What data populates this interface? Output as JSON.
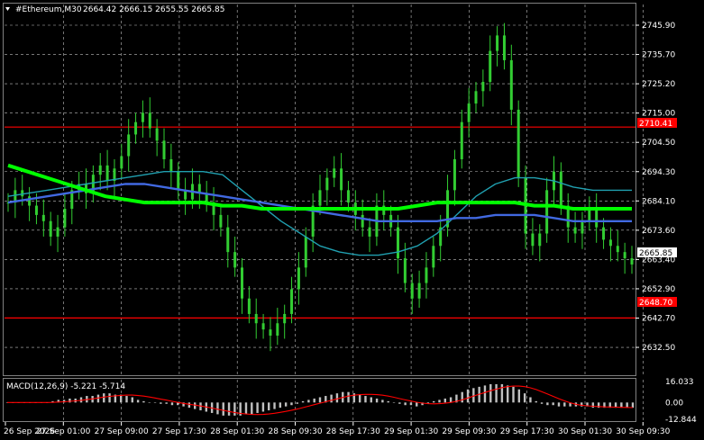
{
  "header": {
    "symbol_timeframe": "#Ethereum,M30",
    "ohlc": "2664.42 2666.15 2655.55 2665.85",
    "dropdown_icon": "triangle-down-icon"
  },
  "macd": {
    "label": "MACD(12,26,9) -5.221 -5.714"
  },
  "price_axis": {
    "ticks": [
      "2745.90",
      "2735.70",
      "2725.20",
      "2715.00",
      "2704.50",
      "2694.30",
      "2684.10",
      "2673.60",
      "2663.40",
      "2652.90",
      "2642.70",
      "2632.50"
    ],
    "current_price": "2665.85",
    "resistance_label": "2710.41",
    "support_label": "2648.70"
  },
  "macd_axis": {
    "ticks": [
      "16.033",
      "0.00",
      "-12.844"
    ]
  },
  "time_axis": {
    "ticks": [
      "26 Sep 2026",
      "27 Sep 01:00",
      "27 Sep 09:00",
      "27 Sep 17:30",
      "28 Sep 01:30",
      "28 Sep 09:30",
      "28 Sep 17:30",
      "29 Sep 01:30",
      "29 Sep 09:30",
      "29 Sep 17:30",
      "30 Sep 01:30",
      "30 Sep 09:30"
    ]
  },
  "colors": {
    "background": "#000000",
    "candle": "#32cd32",
    "grid": "#c0c0c0",
    "level_line": "#ff0000",
    "ma_fast": "#20a0b0",
    "ma_mid": "#4169e1",
    "ma_slow": "#00ff00",
    "macd_hist": "#c0c0c0",
    "macd_signal": "#ff0000"
  },
  "chart_data": {
    "type": "candlestick",
    "title": "#Ethereum,M30",
    "ylim": [
      2630.5,
      2750.0
    ],
    "series": [
      {
        "name": "price",
        "values": [
          2686,
          2690,
          2688,
          2685,
          2682,
          2680,
          2675,
          2678,
          2684,
          2690,
          2692,
          2689,
          2695,
          2698,
          2693,
          2697,
          2701,
          2708,
          2712,
          2715,
          2710,
          2706,
          2700,
          2696,
          2690,
          2687,
          2692,
          2689,
          2686,
          2682,
          2678,
          2670,
          2665,
          2655,
          2650,
          2647,
          2645,
          2643,
          2647,
          2650,
          2658,
          2665,
          2675,
          2685,
          2690,
          2694,
          2697,
          2690,
          2686,
          2682,
          2678,
          2675,
          2685,
          2682,
          2678,
          2668,
          2660,
          2655,
          2660,
          2665,
          2672,
          2678,
          2690,
          2700,
          2712,
          2718,
          2722,
          2725,
          2735,
          2740,
          2732,
          2716,
          2694,
          2676,
          2672,
          2676,
          2690,
          2696,
          2685,
          2678,
          2676,
          2680,
          2684,
          2678,
          2674,
          2672,
          2670,
          2668,
          2666
        ]
      },
      {
        "name": "",
        "values": [
          2688,
          2689,
          2690,
          2691,
          2692,
          2693,
          2694,
          2695,
          2696,
          2696,
          2696,
          2695,
          2690,
          2685,
          2680,
          2676,
          2672,
          2670,
          2669,
          2669,
          2670,
          2672,
          2676,
          2682,
          2688,
          2692,
          2694,
          2694,
          2693,
          2691,
          2690,
          2690,
          2690
        ]
      },
      {
        "name": "",
        "values": [
          2686,
          2687,
          2688,
          2689,
          2690,
          2691,
          2692,
          2692,
          2691,
          2690,
          2689,
          2688,
          2687,
          2686,
          2685,
          2684,
          2683,
          2682,
          2681,
          2680,
          2680,
          2680,
          2680,
          2681,
          2681,
          2682,
          2682,
          2682,
          2681,
          2680,
          2680,
          2680,
          2680
        ]
      },
      {
        "name": "",
        "values": [
          2698,
          2696,
          2694,
          2692,
          2690,
          2688,
          2687,
          2686,
          2686,
          2686,
          2686,
          2685,
          2685,
          2684,
          2684,
          2684,
          2684,
          2684,
          2684,
          2684,
          2684,
          2685,
          2686,
          2686,
          2686,
          2686,
          2686,
          2685,
          2685,
          2684,
          2684,
          2684,
          2684
        ]
      }
    ],
    "hlines": [
      2710.41,
      2648.7
    ],
    "macd": {
      "ylim": [
        -12.844,
        16.033
      ],
      "hist": [
        0,
        0,
        0,
        0,
        0,
        0,
        0,
        0,
        1,
        2,
        2,
        3,
        3,
        4,
        5,
        5,
        6,
        7,
        7,
        6,
        6,
        5,
        4,
        2,
        1,
        0,
        0,
        -1,
        -1,
        -2,
        -2,
        -3,
        -4,
        -5,
        -6,
        -7,
        -8,
        -9,
        -10,
        -10,
        -10,
        -10,
        -9,
        -9,
        -8,
        -7,
        -6,
        -5,
        -4,
        -3,
        -2,
        -1,
        1,
        2,
        3,
        4,
        5,
        6,
        7,
        8,
        8,
        7,
        6,
        5,
        4,
        3,
        2,
        1,
        0,
        -1,
        -2,
        -2,
        -3,
        -2,
        -1,
        1,
        2,
        3,
        4,
        6,
        8,
        10,
        11,
        12,
        13,
        14,
        14,
        14,
        13,
        12,
        10,
        7,
        4,
        1,
        -1,
        -2,
        -2,
        -3,
        -3,
        -3,
        -3,
        -3,
        -3,
        -4,
        -4,
        -4,
        -4,
        -4,
        -4,
        -4,
        -4
      ]
    }
  }
}
